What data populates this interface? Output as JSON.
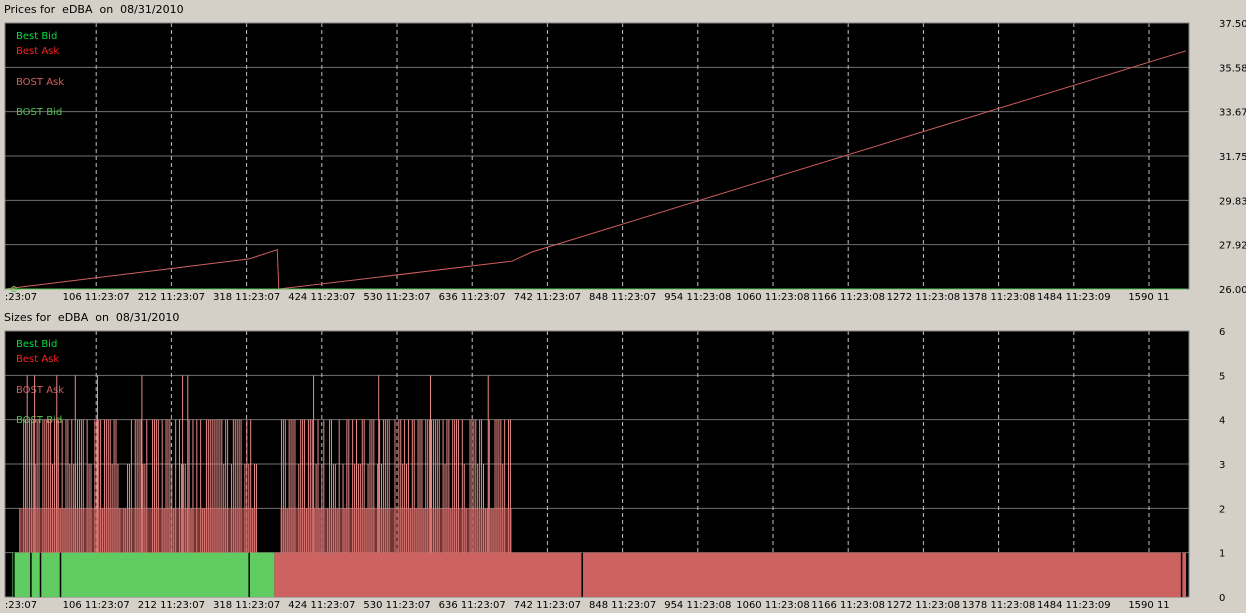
{
  "panels": {
    "prices": {
      "title": "Prices for  eDBA  on  08/31/2010"
    },
    "sizes": {
      "title": "Sizes for  eDBA  on  08/31/2010"
    }
  },
  "colors": {
    "background": "#000000",
    "grid_h": "#707070",
    "grid_v": "#c0c0c0",
    "best_bid": "#00e040",
    "best_ask": "#ff2020",
    "bost_ask": "#d06060",
    "bost_bid": "#50c050",
    "size_bid_fill": "#5fcb60",
    "size_ask_fill": "#cd6361",
    "size_ask_line": "#e88a86"
  },
  "chart_data": [
    {
      "type": "line",
      "title": "Prices for  eDBA  on  08/31/2010",
      "legend": [
        "Best Bid",
        "Best Ask",
        "BOST Ask",
        "BOST Bid"
      ],
      "legend_placement": "top-left",
      "grid": true,
      "xlim": [
        0,
        1600
      ],
      "ylim": [
        26.0,
        37.5
      ],
      "ytick_labels": [
        "37.50",
        "35.58",
        "33.67",
        "31.75",
        "29.83",
        "27.92",
        "26.00"
      ],
      "xtick_labels": [
        ":23:07",
        "106 11:23:07",
        "212 11:23:07",
        "318 11:23:07",
        "424 11:23:07",
        "530 11:23:07",
        "636 11:23:07",
        "742 11:23:07",
        "848 11:23:07",
        "954 11:23:08",
        "1060 11:23:08",
        "1166 11:23:08",
        "1272 11:23:08",
        "1378 11:23:08",
        "1484 11:23:09",
        "1590 11"
      ],
      "series": [
        {
          "name": "BOST Ask",
          "points": [
            [
              0,
              26.0
            ],
            [
              330,
              27.3
            ],
            [
              368,
              27.7
            ],
            [
              370,
              26.0
            ],
            [
              685,
              27.2
            ],
            [
              712,
              27.6
            ],
            [
              1596,
              36.3
            ]
          ]
        },
        {
          "name": "BOST Bid",
          "points": [
            [
              0,
              26.0
            ],
            [
              1596,
              26.0
            ]
          ]
        }
      ]
    },
    {
      "type": "bar",
      "title": "Sizes for  eDBA  on  08/31/2010",
      "legend": [
        "Best Bid",
        "Best Ask",
        "BOST Ask",
        "BOST Bid"
      ],
      "legend_placement": "top-left",
      "grid": true,
      "xlim": [
        0,
        1600
      ],
      "ylim": [
        0,
        6
      ],
      "ytick_labels": [
        "6",
        "5",
        "4",
        "3",
        "2",
        "1",
        "0"
      ],
      "xtick_labels": [
        ":23:07",
        "106 11:23:07",
        "212 11:23:07",
        "318 11:23:07",
        "424 11:23:07",
        "530 11:23:07",
        "636 11:23:07",
        "742 11:23:07",
        "848 11:23:07",
        "954 11:23:08",
        "1060 11:23:08",
        "1166 11:23:08",
        "1272 11:23:08",
        "1378 11:23:08",
        "1484 11:23:09",
        "1590 11"
      ],
      "bid_size": {
        "value": 1,
        "x_range": [
          10,
          364
        ]
      },
      "ask_size": {
        "value": 1,
        "x_range": [
          364,
          1596
        ]
      },
      "ask_spikes": {
        "x_range": [
          20,
          685
        ],
        "gap": [
          340,
          372
        ],
        "levels": [
          1,
          2,
          3,
          4,
          5
        ],
        "peak_x": [
          30,
          40,
          70,
          95,
          125,
          185,
          240,
          247,
          417,
          505,
          575,
          653
        ]
      }
    }
  ]
}
